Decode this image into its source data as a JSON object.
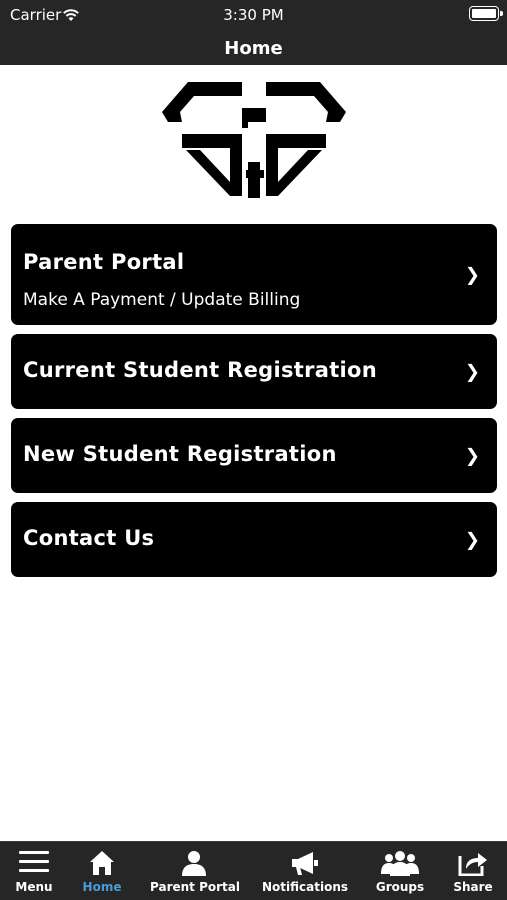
{
  "status_bar": {
    "carrier": "Carrier",
    "time": "3:30 PM"
  },
  "nav": {
    "title": "Home"
  },
  "menu_items": [
    {
      "label": "Parent Portal",
      "sublabel": "Make A Payment / Update Billing",
      "chevron": "❯"
    },
    {
      "label": "Current Student Registration",
      "chevron": "❯"
    },
    {
      "label": "New Student Registration",
      "chevron": "❯"
    },
    {
      "label": "Contact Us",
      "chevron": "❯"
    }
  ],
  "tabs": [
    {
      "label": "Menu",
      "icon": "hamburger-menu-icon"
    },
    {
      "label": "Home",
      "icon": "home-icon",
      "active": true
    },
    {
      "label": "Parent Portal",
      "icon": "person-icon"
    },
    {
      "label": "Notifications",
      "icon": "megaphone-icon"
    },
    {
      "label": "Groups",
      "icon": "group-icon"
    },
    {
      "label": "Share",
      "icon": "share-icon"
    }
  ],
  "colors": {
    "bar_background": "#262626",
    "card_background": "#000000",
    "active_tab": "#4a9bd9"
  }
}
